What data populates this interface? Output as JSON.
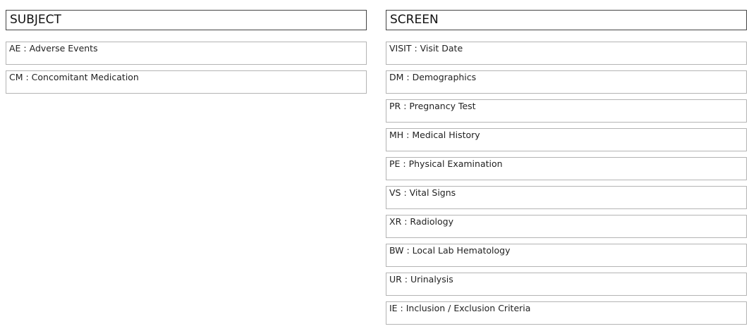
{
  "subject": {
    "title": "SUBJECT",
    "items": [
      {
        "label": "AE : Adverse Events"
      },
      {
        "label": "CM : Concomitant Medication"
      }
    ]
  },
  "screen": {
    "title": "SCREEN",
    "items": [
      {
        "label": "VISIT : Visit Date"
      },
      {
        "label": "DM : Demographics"
      },
      {
        "label": "PR : Pregnancy Test"
      },
      {
        "label": "MH : Medical History"
      },
      {
        "label": "PE : Physical Examination"
      },
      {
        "label": "VS : Vital Signs"
      },
      {
        "label": "XR : Radiology"
      },
      {
        "label": "BW : Local Lab Hematology"
      },
      {
        "label": "UR : Urinalysis"
      },
      {
        "label": "IE : Inclusion / Exclusion Criteria"
      }
    ]
  }
}
